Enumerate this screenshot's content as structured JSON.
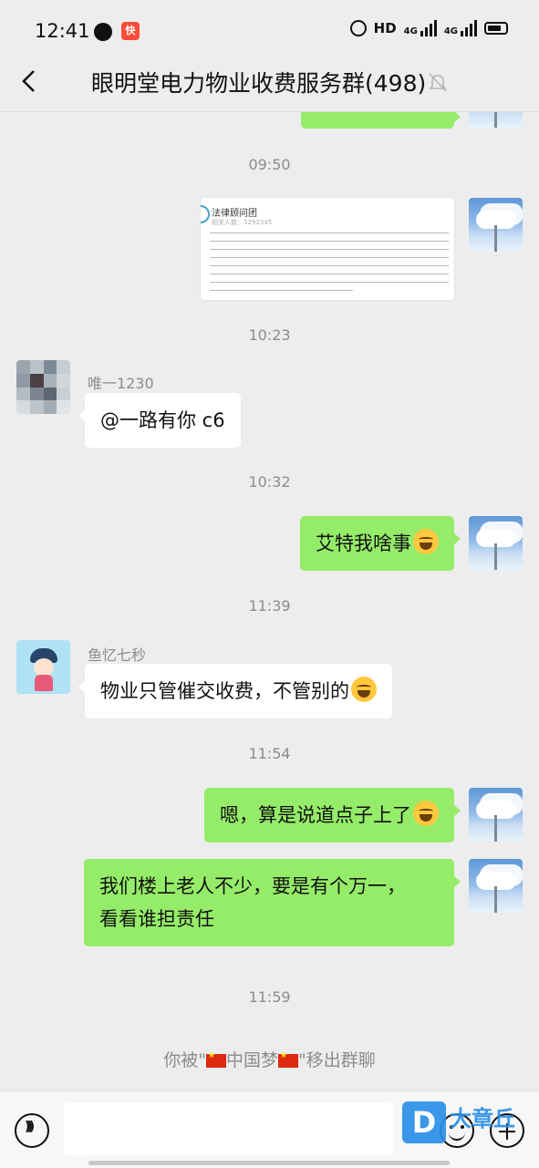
{
  "status_bar": {
    "time": "12:41",
    "network": "HD",
    "signal1": "4G",
    "signal2": "4G"
  },
  "header": {
    "title": "眼明堂电力物业收费服务群(498)"
  },
  "timestamps": [
    "09:50",
    "10:23",
    "10:32",
    "11:39",
    "11:54",
    "11:59"
  ],
  "messages": {
    "doc_card": {
      "title": "法律顾问团",
      "subtitle": "相关人数：3292345"
    },
    "m1": {
      "sender": "唯一1230",
      "text": "@一路有你 c6"
    },
    "m2": {
      "text": "艾特我啥事"
    },
    "m3": {
      "sender": "鱼忆七秒",
      "text": "物业只管催交收费，不管别的"
    },
    "m4": {
      "text": "嗯，算是说道点子上了"
    },
    "m5": {
      "line1": "我们楼上老人不少，要是有个万一，",
      "line2": "看看谁担责任"
    }
  },
  "system": {
    "prefix": "你被\"",
    "name": "中国梦",
    "suffix": "\"移出群聊"
  },
  "input": {
    "placeholder": ""
  },
  "watermark": {
    "text": "大章丘",
    "logo": "D"
  },
  "icons": {
    "back": "back-arrow-icon",
    "mute": "mute-bell-icon",
    "voice": "voice-icon",
    "emoji": "emoji-icon",
    "plus": "plus-icon",
    "alarm": "alarm-icon",
    "battery": "battery-icon"
  },
  "colors": {
    "my_bubble": "#95ec69",
    "their_bubble": "#ffffff",
    "background": "#ededed"
  }
}
